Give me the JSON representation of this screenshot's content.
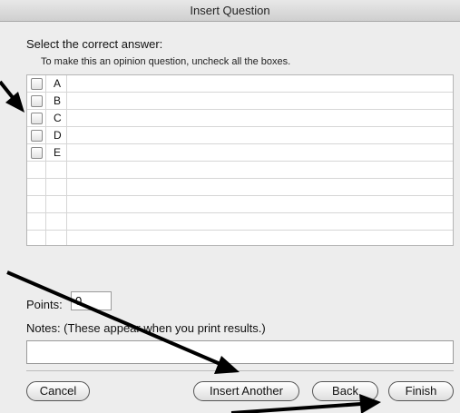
{
  "window": {
    "title": "Insert Question"
  },
  "select_label": "Select the correct answer:",
  "hint": "To make this an opinion question, uncheck all the boxes.",
  "answers": [
    {
      "letter": "A",
      "checked": false
    },
    {
      "letter": "B",
      "checked": false
    },
    {
      "letter": "C",
      "checked": false
    },
    {
      "letter": "D",
      "checked": false
    },
    {
      "letter": "E",
      "checked": false
    }
  ],
  "points": {
    "label": "Points:",
    "value": "0"
  },
  "notes": {
    "label": "Notes: (These appear when you print results.)",
    "value": ""
  },
  "buttons": {
    "cancel": "Cancel",
    "insert_another": "Insert Another",
    "back": "Back",
    "finish": "Finish"
  }
}
